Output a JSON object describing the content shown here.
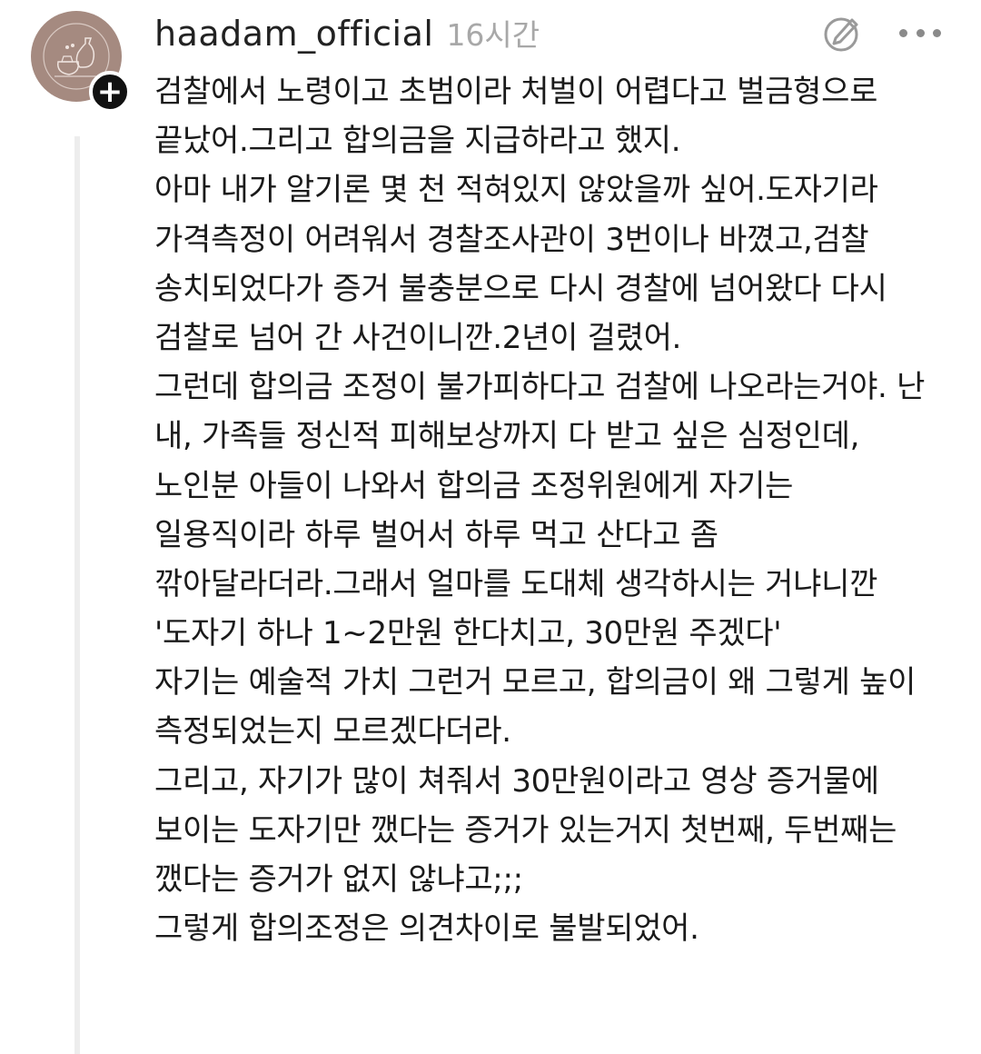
{
  "comment": {
    "author": {
      "username": "haadam_official",
      "avatar_icon": "shop-logo-avatar",
      "avatar_color": "#a58a80"
    },
    "timestamp": "16시간",
    "actions": {
      "edit_icon": "edit-slash-circle-icon",
      "more_icon": "more-dots-icon"
    },
    "follow_badge_icon": "plus-icon",
    "body_lines": [
      "검찰에서 노령이고 초범이라 처벌이 어렵다고 벌금형으로",
      "끝났어.그리고 합의금을 지급하라고 했지.",
      "아마 내가 알기론 몇 천 적혀있지 않았을까 싶어.도자기라",
      "가격측정이 어려워서 경찰조사관이 3번이나 바꼈고,검찰",
      "송치되었다가 증거 불충분으로 다시 경찰에 넘어왔다 다시",
      "검찰로 넘어 간 사건이니깐.2년이 걸렸어.",
      "그런데 합의금 조정이 불가피하다고 검찰에 나오라는거야. 난",
      "내, 가족들 정신적 피해보상까지 다 받고 싶은 심정인데,",
      "노인분 아들이 나와서 합의금 조정위원에게 자기는",
      "일용직이라 하루 벌어서 하루 먹고 산다고 좀",
      "깎아달라더라.그래서 얼마를 도대체 생각하시는 거냐니깐",
      "'도자기 하나 1~2만원 한다치고, 30만원 주겠다'",
      "자기는 예술적 가치 그런거 모르고, 합의금이 왜 그렇게 높이",
      "측정되었는지 모르겠다더라.",
      "그리고, 자기가 많이 쳐줘서 30만원이라고 영상 증거물에",
      "보이는 도자기만 깼다는 증거가 있는거지 첫번째, 두번째는",
      "깼다는 증거가 없지 않냐고;;;",
      "그렇게 합의조정은 의견차이로 불발되었어."
    ]
  }
}
